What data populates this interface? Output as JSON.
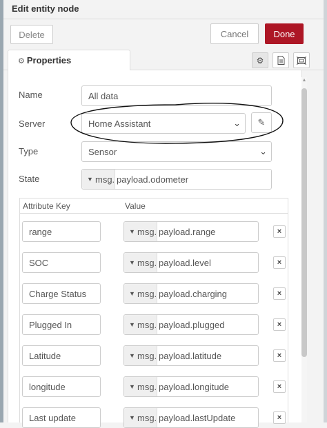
{
  "dialog": {
    "title": "Edit entity node",
    "delete_label": "Delete",
    "cancel_label": "Cancel",
    "done_label": "Done"
  },
  "tabs": {
    "properties_label": "Properties",
    "icons": [
      "gear-icon",
      "description-icon",
      "appearance-icon"
    ]
  },
  "form": {
    "name_label": "Name",
    "name_value": "All data",
    "server_label": "Server",
    "server_value": "Home Assistant",
    "type_label": "Type",
    "type_value": "Sensor",
    "state_label": "State",
    "state_prefix": "msg.",
    "state_value": "payload.odometer"
  },
  "attributes": {
    "key_header": "Attribute Key",
    "value_header": "Value",
    "rows": [
      {
        "key": "range",
        "prefix": "msg.",
        "value": "payload.range"
      },
      {
        "key": "SOC",
        "prefix": "msg.",
        "value": "payload.level"
      },
      {
        "key": "Charge Status",
        "prefix": "msg.",
        "value": "payload.charging"
      },
      {
        "key": "Plugged In",
        "prefix": "msg.",
        "value": "payload.plugged"
      },
      {
        "key": "Latitude",
        "prefix": "msg.",
        "value": "payload.latitude"
      },
      {
        "key": "longitude",
        "prefix": "msg.",
        "value": "payload.longitude"
      },
      {
        "key": "Last update",
        "prefix": "msg.",
        "value": "payload.lastUpdate"
      }
    ],
    "remove_glyph": "×"
  },
  "colors": {
    "done_button": "#ad1625",
    "annotation_stroke": "#111111"
  }
}
